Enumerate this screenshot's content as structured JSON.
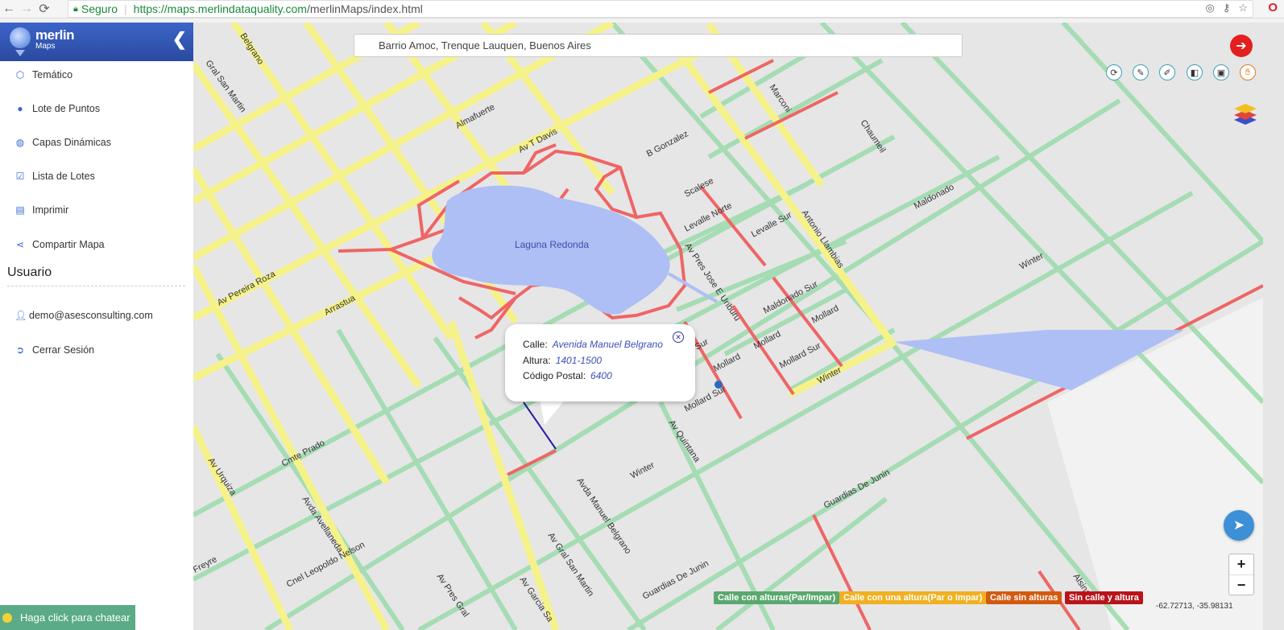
{
  "browser": {
    "secure_label": "Seguro",
    "url_host": "https://maps.merlindataquality.com",
    "url_path": "/merlinMaps/index.html"
  },
  "sidebar": {
    "brand_name": "merlin",
    "brand_sub": "Maps",
    "items": [
      {
        "label": "Temático",
        "icon": "cube-icon"
      },
      {
        "label": "Lote de Puntos",
        "icon": "map-marker-icon"
      },
      {
        "label": "Capas Dinámicas",
        "icon": "globe-icon"
      },
      {
        "label": "Lista de Lotes",
        "icon": "checkbox-icon"
      },
      {
        "label": "Imprimir",
        "icon": "print-icon"
      },
      {
        "label": "Compartir Mapa",
        "icon": "share-icon"
      }
    ],
    "user_section_title": "Usuario",
    "user_items": [
      {
        "label": "demo@asesconsulting.com",
        "icon": "user-icon"
      },
      {
        "label": "Cerrar Sesión",
        "icon": "logout-icon"
      }
    ],
    "chat_label": "Haga click para chatear"
  },
  "map": {
    "search_value": "Barrio Amoc, Trenque Lauquen, Buenos Aires",
    "labels": {
      "laguna": "Laguna Redonda",
      "belgrano": "Belgrano",
      "gral_san_martin_top": "Gral San Martin",
      "almafuerte": "Almafuerte",
      "av_tdavis": "Av T Davis",
      "b_gonzalez": "B Gonzalez",
      "marconi": "Marconi",
      "chaumeil": "Chaumeil",
      "scalese": "Scalese",
      "levalle_norte": "Levalle Norte",
      "levalle_sur": "Levalle Sur",
      "antonio_llambias": "Antonio Llambias",
      "maldonado": "Maldonado",
      "av_pres_urquiza": "Av Pres Jose E Uriburu",
      "maldonado_sur": "Maldonado Sur",
      "winter_right": "Winter",
      "mollard1": "Mollard",
      "mollard2": "Mollard",
      "mollard3": "Mollard",
      "mollard_sur1": "Mollard Sur",
      "mollard_sur2": "Mollard Sur",
      "winter_mid": "Winter",
      "av_pereira_roza": "Av Pereira Roza",
      "arrastua": "Arrastua",
      "sur": "Sur",
      "av_quintana": "Av Quintana",
      "winter_low": "Winter",
      "guardias_de_junin1": "Guardias De Junin",
      "guardias_de_junin2": "Guardias De Junin",
      "cmte_prado": "Cmte Prado",
      "av_urquiza": "Av Urquiza",
      "avda_avellaneda": "Avda Avellaneda",
      "cnel_leopoldo_nelson": "Cnel Leopoldo Nelson",
      "freyre": "Freyre",
      "av_pres_gral": "Av Pres Gral",
      "av_garcia_salinas": "Av Garcia Sa",
      "av_gral_san_martin": "Av Gral San Martin",
      "avda_manuel_belgrano": "Avda Manuel Belgrano",
      "alsina": "Alsina"
    }
  },
  "popup": {
    "calle_label": "Calle:",
    "calle_value": "Avenida Manuel Belgrano",
    "altura_label": "Altura:",
    "altura_value": "1401-1500",
    "cp_label": "Código Postal:",
    "cp_value": "6400"
  },
  "legend": [
    {
      "label": "Calle con alturas(Par/Impar)",
      "color": "#5aa86e"
    },
    {
      "label": "Calle con una altura(Par o Impar)",
      "color": "#f0b020"
    },
    {
      "label": "Calle sin alturas",
      "color": "#d35a10"
    },
    {
      "label": "Sin calle y altura",
      "color": "#b8141a"
    }
  ],
  "coords": "-62.72713, -35.98131",
  "colors": {
    "yellow_road": "#f4f080",
    "green_road": "#8fd4a0",
    "red_road": "#ef5a5a",
    "water": "#aebff5",
    "sidebar_header": "#2f55b5"
  }
}
